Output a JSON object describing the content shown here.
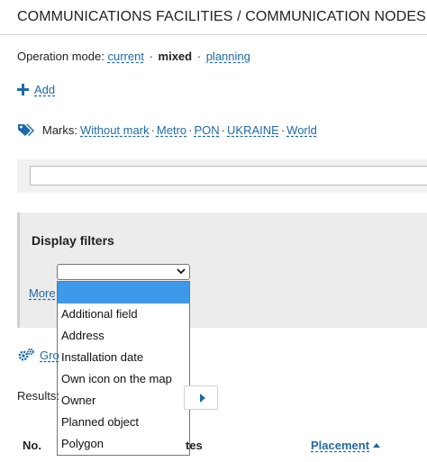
{
  "header": {
    "title": "COMMUNICATIONS FACILITIES / COMMUNICATION NODES"
  },
  "operation_mode": {
    "label": "Operation mode:",
    "current": "current",
    "mixed": "mixed",
    "planning": "planning",
    "separator": "·"
  },
  "add": {
    "label": "Add"
  },
  "marks": {
    "label": "Marks:",
    "items": [
      "Without mark",
      "Metro",
      "PON",
      "UKRAINE",
      "World"
    ]
  },
  "filters": {
    "title": "Display filters",
    "more_label": "More",
    "select_value": "",
    "options": [
      "",
      "Additional field",
      "Address",
      "Installation date",
      "Own icon on the map",
      "Owner",
      "Planned object",
      "Polygon"
    ]
  },
  "group": {
    "label_visible": "Gro"
  },
  "results": {
    "label": "Results:"
  },
  "table": {
    "col_no": "No.",
    "col_partial": "tes",
    "col_placement": "Placement"
  },
  "colors": {
    "link": "#1f6aa8",
    "selected_option": "#3d99ea"
  }
}
